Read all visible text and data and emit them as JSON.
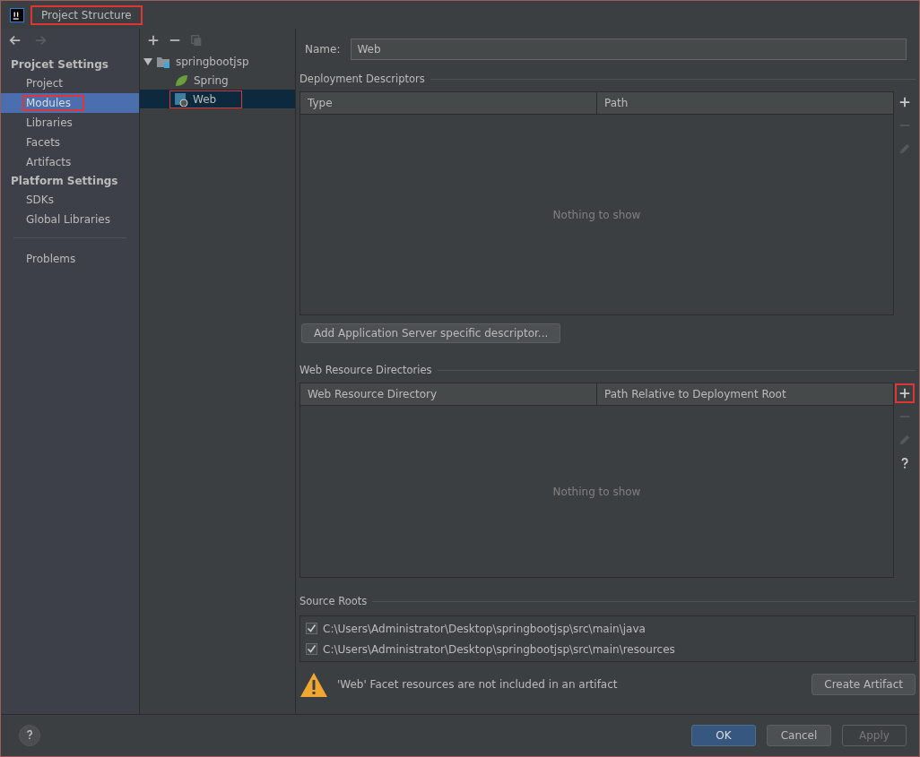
{
  "window": {
    "title": "Project Structure",
    "annotated": true
  },
  "sidebar": {
    "groups": [
      {
        "title": "Projcet Settings",
        "items": [
          {
            "label": "Project",
            "selected": false
          },
          {
            "label": "Modules",
            "selected": true,
            "annotated": true
          },
          {
            "label": "Libraries",
            "selected": false
          },
          {
            "label": "Facets",
            "selected": false
          },
          {
            "label": "Artifacts",
            "selected": false
          }
        ]
      },
      {
        "title": "Platform Settings",
        "items": [
          {
            "label": "SDKs",
            "selected": false
          },
          {
            "label": "Global Libraries",
            "selected": false
          }
        ]
      }
    ],
    "extra_items": [
      {
        "label": "Problems",
        "selected": false
      }
    ]
  },
  "tree": {
    "toolbar": [
      {
        "kind": "add",
        "disabled": false
      },
      {
        "kind": "remove",
        "disabled": false
      },
      {
        "kind": "copy",
        "disabled": true
      }
    ],
    "items": [
      {
        "label": "springbootjsp",
        "kind": "module",
        "expanded": true,
        "selected": false,
        "children": [
          {
            "label": "Spring",
            "kind": "spring",
            "selected": false
          },
          {
            "label": "Web",
            "kind": "web",
            "selected": true,
            "annotated": true
          }
        ]
      }
    ]
  },
  "name_field": {
    "label": "Name:",
    "value": "Web"
  },
  "sections": [
    {
      "title": "Deployment Descriptors",
      "columns": [
        "Type",
        "Path"
      ],
      "empty_text": "Nothing to show",
      "side_tools": [
        {
          "kind": "add",
          "disabled": false
        },
        {
          "kind": "remove",
          "disabled": true
        },
        {
          "kind": "edit",
          "disabled": true
        }
      ],
      "button": "Add Application Server specific descriptor..."
    },
    {
      "title": "Web Resource Directories",
      "columns": [
        "Web Resource Directory",
        "Path Relative to Deployment Root"
      ],
      "empty_text": "Nothing to show",
      "side_tools": [
        {
          "kind": "add",
          "disabled": false,
          "annotated": true
        },
        {
          "kind": "remove",
          "disabled": true
        },
        {
          "kind": "edit",
          "disabled": true
        },
        {
          "kind": "help",
          "disabled": false
        }
      ]
    }
  ],
  "source_roots": {
    "title": "Source Roots",
    "items": [
      {
        "path": "C:\\Users\\Administrator\\Desktop\\springbootjsp\\src\\main\\java",
        "checked": true
      },
      {
        "path": "C:\\Users\\Administrator\\Desktop\\springbootjsp\\src\\main\\resources",
        "checked": true
      }
    ]
  },
  "warning": {
    "text": "'Web' Facet resources are not included in an artifact",
    "button": "Create Artifact"
  },
  "footer": {
    "buttons": [
      {
        "label": "OK",
        "kind": "default",
        "disabled": false
      },
      {
        "label": "Cancel",
        "kind": "normal",
        "disabled": false
      },
      {
        "label": "Apply",
        "kind": "normal",
        "disabled": true
      }
    ]
  }
}
